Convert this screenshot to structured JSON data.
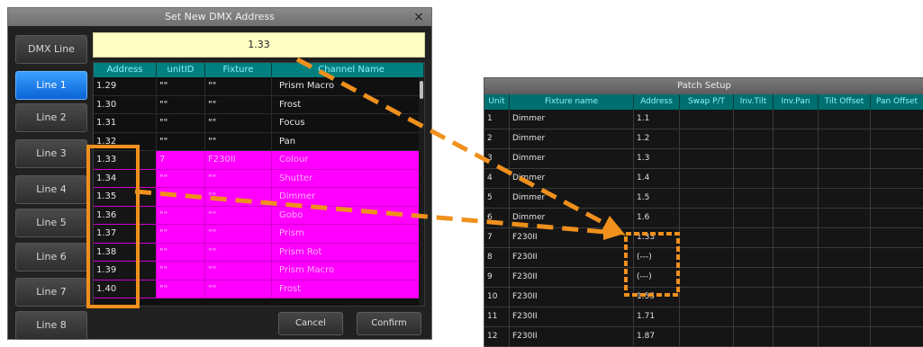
{
  "dmx_dialog": {
    "title": "Set New DMX Address",
    "close_glyph": "×",
    "dmx_line_label": "DMX Line",
    "address_value": "1.33",
    "lines": [
      "Line 1",
      "Line 2",
      "Line 3",
      "Line 4",
      "Line 5",
      "Line 6",
      "Line 7",
      "Line 8"
    ],
    "active_line": "Line 1",
    "columns": [
      "Address",
      "unitID",
      "Fixture",
      "Channel Name"
    ],
    "rows": [
      {
        "address": "1.29",
        "unit_id": "\"\"",
        "fixture": "\"\"",
        "channel": "Prism Macro",
        "highlight": false
      },
      {
        "address": "1.30",
        "unit_id": "\"\"",
        "fixture": "\"\"",
        "channel": "Frost",
        "highlight": false
      },
      {
        "address": "1.31",
        "unit_id": "\"\"",
        "fixture": "\"\"",
        "channel": "Focus",
        "highlight": false
      },
      {
        "address": "1.32",
        "unit_id": "\"\"",
        "fixture": "\"\"",
        "channel": "Pan",
        "highlight": false
      },
      {
        "address": "1.33",
        "unit_id": "7",
        "fixture": "F230II",
        "channel": "Colour",
        "highlight": true
      },
      {
        "address": "1.34",
        "unit_id": "\"\"",
        "fixture": "\"\"",
        "channel": "Shutter",
        "highlight": true
      },
      {
        "address": "1.35",
        "unit_id": "\"\"",
        "fixture": "\"\"",
        "channel": "Dimmer",
        "highlight": true
      },
      {
        "address": "1.36",
        "unit_id": "\"\"",
        "fixture": "\"\"",
        "channel": "Gobo",
        "highlight": true
      },
      {
        "address": "1.37",
        "unit_id": "\"\"",
        "fixture": "\"\"",
        "channel": "Prism",
        "highlight": true
      },
      {
        "address": "1.38",
        "unit_id": "\"\"",
        "fixture": "\"\"",
        "channel": "Prism Rot",
        "highlight": true
      },
      {
        "address": "1.39",
        "unit_id": "\"\"",
        "fixture": "\"\"",
        "channel": "Prism Macro",
        "highlight": true
      },
      {
        "address": "1.40",
        "unit_id": "\"\"",
        "fixture": "\"\"",
        "channel": "Frost",
        "highlight": true
      }
    ],
    "cancel_label": "Cancel",
    "confirm_label": "Confirm",
    "highlight_color": "#ff00ff"
  },
  "patch_setup": {
    "title": "Patch Setup",
    "columns": [
      "Unit",
      "Fixture name",
      "Address",
      "Swap P/T",
      "Inv.Tilt",
      "Inv.Pan",
      "Tilt Offset",
      "Pan Offset"
    ],
    "rows": [
      {
        "unit": "1",
        "name": "Dimmer",
        "address": "1.1"
      },
      {
        "unit": "2",
        "name": "Dimmer",
        "address": "1.2"
      },
      {
        "unit": "3",
        "name": "Dimmer",
        "address": "1.3"
      },
      {
        "unit": "4",
        "name": "Dimmer",
        "address": "1.4"
      },
      {
        "unit": "5",
        "name": "Dimmer",
        "address": "1.5"
      },
      {
        "unit": "6",
        "name": "Dimmer",
        "address": "1.6"
      },
      {
        "unit": "7",
        "name": "F230II",
        "address": "1.33"
      },
      {
        "unit": "8",
        "name": "F230II",
        "address": "(---)"
      },
      {
        "unit": "9",
        "name": "F230II",
        "address": "(---)"
      },
      {
        "unit": "10",
        "name": "F230II",
        "address": "1.55"
      },
      {
        "unit": "11",
        "name": "F230II",
        "address": "1.71"
      },
      {
        "unit": "12",
        "name": "F230II",
        "address": "1.87"
      }
    ]
  },
  "annotation_color": "#f0901c"
}
